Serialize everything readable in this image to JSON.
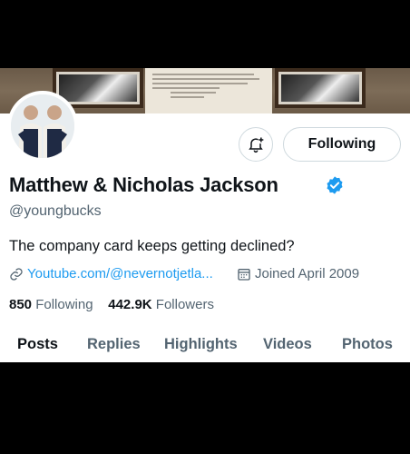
{
  "profile": {
    "display_name": "Matthew & Nicholas Jackson",
    "handle": "@youngbucks",
    "bio": "The company card keeps getting declined?",
    "link_text": "Youtube.com/@nevernotjetla...",
    "joined_text": "Joined April 2009",
    "verified": true
  },
  "actions": {
    "follow_label": "Following",
    "notification_icon": "bell-plus-icon"
  },
  "stats": {
    "following_count": "850",
    "following_label": "Following",
    "followers_count": "442.9K",
    "followers_label": "Followers"
  },
  "tabs": [
    {
      "label": "Posts",
      "active": true
    },
    {
      "label": "Replies",
      "active": false
    },
    {
      "label": "Highlights",
      "active": false
    },
    {
      "label": "Videos",
      "active": false
    },
    {
      "label": "Photos",
      "active": false
    }
  ],
  "colors": {
    "link": "#1d9bf0",
    "verified": "#1d9bf0",
    "text_primary": "#0f1419",
    "text_secondary": "#536471"
  }
}
